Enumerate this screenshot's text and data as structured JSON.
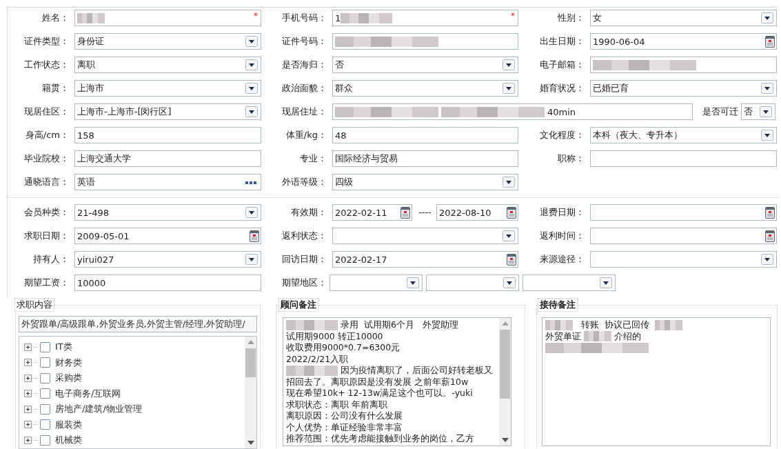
{
  "personal": {
    "fields": [
      {
        "label": "姓名：",
        "kind": "text",
        "segments": [
          {
            "kind": "blur_short"
          }
        ],
        "required_mark": "*"
      },
      {
        "label": "手机号码：",
        "kind": "text",
        "segments": [
          {
            "kind": "text",
            "text": "1"
          },
          {
            "kind": "blur_medium"
          }
        ],
        "required_mark": "*"
      },
      {
        "label": "性别：",
        "kind": "select",
        "value": "女"
      },
      {
        "label": "证件类型：",
        "kind": "select",
        "value": "身份证"
      },
      {
        "label": "证件号码：",
        "kind": "text",
        "segments": [
          {
            "kind": "blur_long"
          }
        ]
      },
      {
        "label": "出生日期：",
        "kind": "date",
        "value": "1990-06-04"
      },
      {
        "label": "工作状态：",
        "kind": "select",
        "value": "离职"
      },
      {
        "label": "是否海归：",
        "kind": "select",
        "value": "否"
      },
      {
        "label": "电子邮箱：",
        "kind": "text",
        "segments": [
          {
            "kind": "blur_long"
          }
        ]
      },
      {
        "label": "籍贯：",
        "kind": "select",
        "value": "上海市"
      },
      {
        "label": "政治面貌：",
        "kind": "select",
        "value": "群众"
      },
      {
        "label": "婚育状况：",
        "kind": "select",
        "value": "已婚已育"
      },
      {
        "label": "现居住区：",
        "kind": "select",
        "value": "上海市-上海市-[闵行区]"
      },
      {
        "label": "现居住址：",
        "kind": "address",
        "segments": [
          {
            "kind": "blur_long"
          },
          {
            "kind": "blur_long"
          },
          {
            "kind": "text",
            "text": "40min"
          }
        ],
        "extra": {
          "label": "是否可迁",
          "value": "否"
        }
      },
      {
        "label": "身高/cm：",
        "kind": "text",
        "value": "158"
      },
      {
        "label": "体重/kg：",
        "kind": "text",
        "value": "48"
      },
      {
        "label": "文化程度：",
        "kind": "select",
        "value": "本科（夜大、专升本）"
      },
      {
        "label": "毕业院校：",
        "kind": "text",
        "value": "上海交通大学"
      },
      {
        "label": "专业：",
        "kind": "text",
        "value": "国际经济与贸易"
      },
      {
        "label": "职称：",
        "kind": "text"
      },
      {
        "label": "通晓语言：",
        "kind": "lookup",
        "value": "英语"
      },
      {
        "label": "外语等级：",
        "kind": "select",
        "value": "四级"
      }
    ]
  },
  "membership": {
    "fields": [
      {
        "label": "会员种类：",
        "kind": "select",
        "value": "21-498"
      },
      {
        "label": "有效期：",
        "kind": "date_range",
        "values": [
          "2022-02-11",
          "2022-08-10"
        ],
        "separator": "----"
      },
      {
        "label": "退费日期：",
        "kind": "date"
      },
      {
        "label": "求职日期：",
        "kind": "date",
        "value": "2009-05-01"
      },
      {
        "label": "返利状态：",
        "kind": "select"
      },
      {
        "label": "返利时间：",
        "kind": "date"
      },
      {
        "label": "持有人：",
        "kind": "select",
        "value": "yirui027"
      },
      {
        "label": "回访日期：",
        "kind": "date",
        "value": "2022-02-17"
      },
      {
        "label": "来源途径：",
        "kind": "select"
      },
      {
        "label": "期望工资：",
        "kind": "text",
        "value": "10000"
      },
      {
        "label": "期望地区：",
        "kind": "region",
        "selects": [
          {
            "kind": "select"
          },
          {
            "kind": "select"
          },
          {
            "kind": "select"
          }
        ]
      }
    ]
  },
  "panels": [
    {
      "title": "求职内容",
      "kind": "tree",
      "selection": "外贸跟单/高级跟单,外贸业务员,外贸主管/经理,外贸助理/",
      "items": [
        {
          "label": "IT类",
          "checked": false,
          "expanded": false
        },
        {
          "label": "财务类",
          "checked": false,
          "expanded": false
        },
        {
          "label": "采购类",
          "checked": false,
          "expanded": false
        },
        {
          "label": "电子商务/互联网",
          "checked": false,
          "expanded": false
        },
        {
          "label": "房地产/建筑/物业管理",
          "checked": false,
          "expanded": false
        },
        {
          "label": "服装类",
          "checked": false,
          "expanded": false
        },
        {
          "label": "机械类",
          "checked": false,
          "expanded": false
        }
      ]
    },
    {
      "title": "顾问备注",
      "kind": "notes",
      "scrollbar": true,
      "lines": [
        [
          {
            "kind": "blur_medium"
          },
          {
            "kind": "text",
            "text": "录用  试用期6个月   外贸助理"
          }
        ],
        [
          {
            "kind": "text",
            "text": "试用期9000 转正10000"
          }
        ],
        [
          {
            "kind": "text",
            "text": "收取费用9000*0.7=6300元"
          }
        ],
        [
          {
            "kind": "text",
            "text": "2022/2/21入职"
          }
        ],
        [
          {
            "kind": "blur_medium"
          },
          {
            "kind": "text",
            "text": "因为疫情离职了，后面公司好转老板又"
          }
        ],
        [
          {
            "kind": "text",
            "text": "招回去了。离职原因是没有发展 之前年薪10w"
          }
        ],
        [
          {
            "kind": "text",
            "text": "现在希望10k+ 12-13w满足这个也可以。-yuki"
          }
        ],
        [
          {
            "kind": "text",
            "text": "求职状态：离职 年前离职"
          }
        ],
        [
          {
            "kind": "text",
            "text": "离职原因：公司没有什么发展"
          }
        ],
        [
          {
            "kind": "text",
            "text": "个人优势：单证经验非常丰富"
          }
        ],
        [
          {
            "kind": "text",
            "text": "推荐范围：优先考虑能接触到业务的岗位，乙方"
          }
        ]
      ]
    },
    {
      "title": "接待备注",
      "kind": "notes",
      "scrollbar": false,
      "lines": [
        [
          {
            "kind": "blur_short"
          },
          {
            "kind": "text",
            "text": "  转账  协议已回传  "
          },
          {
            "kind": "blur_short"
          }
        ],
        [
          {
            "kind": "text",
            "text": "外贸单证 "
          },
          {
            "kind": "blur_short"
          },
          {
            "kind": "text",
            "text": "介绍的"
          }
        ],
        [
          {
            "kind": "blur_long"
          }
        ]
      ]
    }
  ]
}
